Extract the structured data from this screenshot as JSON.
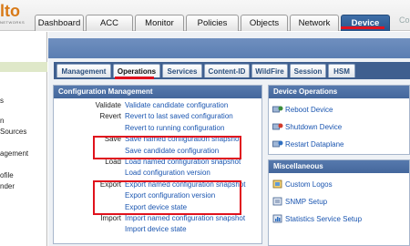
{
  "logo": {
    "text": "lto",
    "tagline": "NETWORKS"
  },
  "main_tabs": [
    {
      "label": "Dashboard"
    },
    {
      "label": "ACC"
    },
    {
      "label": "Monitor"
    },
    {
      "label": "Policies"
    },
    {
      "label": "Objects"
    },
    {
      "label": "Network"
    },
    {
      "label": "Device",
      "active": true
    }
  ],
  "topbar_cut_text": "Co",
  "left_nav": [
    "s",
    "n",
    "Sources",
    "agement",
    "ofile",
    "nder"
  ],
  "sub_tabs": [
    {
      "label": "Management"
    },
    {
      "label": "Operations",
      "active": true
    },
    {
      "label": "Services"
    },
    {
      "label": "Content-ID"
    },
    {
      "label": "WildFire"
    },
    {
      "label": "Session"
    },
    {
      "label": "HSM"
    }
  ],
  "config_mgmt": {
    "title": "Configuration Management",
    "rows": [
      {
        "label": "Validate",
        "link": "Validate candidate configuration"
      },
      {
        "label": "Revert",
        "link": "Revert to last saved configuration"
      },
      {
        "label": "",
        "link": "Revert to running configuration"
      },
      {
        "label": "Save",
        "link": "Save named configuration snapshot"
      },
      {
        "label": "",
        "link": "Save candidate configuration"
      },
      {
        "label": "Load",
        "link": "Load named configuration snapshot"
      },
      {
        "label": "",
        "link": "Load configuration version"
      },
      {
        "label": "Export",
        "link": "Export named configuration snapshot"
      },
      {
        "label": "",
        "link": "Export configuration version"
      },
      {
        "label": "",
        "link": "Export device state"
      },
      {
        "label": "Import",
        "link": "Import named configuration snapshot"
      },
      {
        "label": "",
        "link": "Import device state"
      }
    ]
  },
  "device_ops": {
    "title": "Device Operations",
    "items": [
      {
        "label": "Reboot Device",
        "icon": "reboot-icon"
      },
      {
        "label": "Shutdown Device",
        "icon": "shutdown-icon"
      },
      {
        "label": "Restart Dataplane",
        "icon": "restart-icon"
      }
    ]
  },
  "misc": {
    "title": "Miscellaneous",
    "items": [
      {
        "label": "Custom Logos",
        "icon": "logo-icon"
      },
      {
        "label": "SNMP Setup",
        "icon": "snmp-icon"
      },
      {
        "label": "Statistics Service Setup",
        "icon": "statistics-icon"
      }
    ]
  },
  "colors": {
    "accent_blue": "#44679c",
    "link_blue": "#1a55b0",
    "highlight_red": "#e0121d",
    "logo_orange": "#d87a18"
  }
}
